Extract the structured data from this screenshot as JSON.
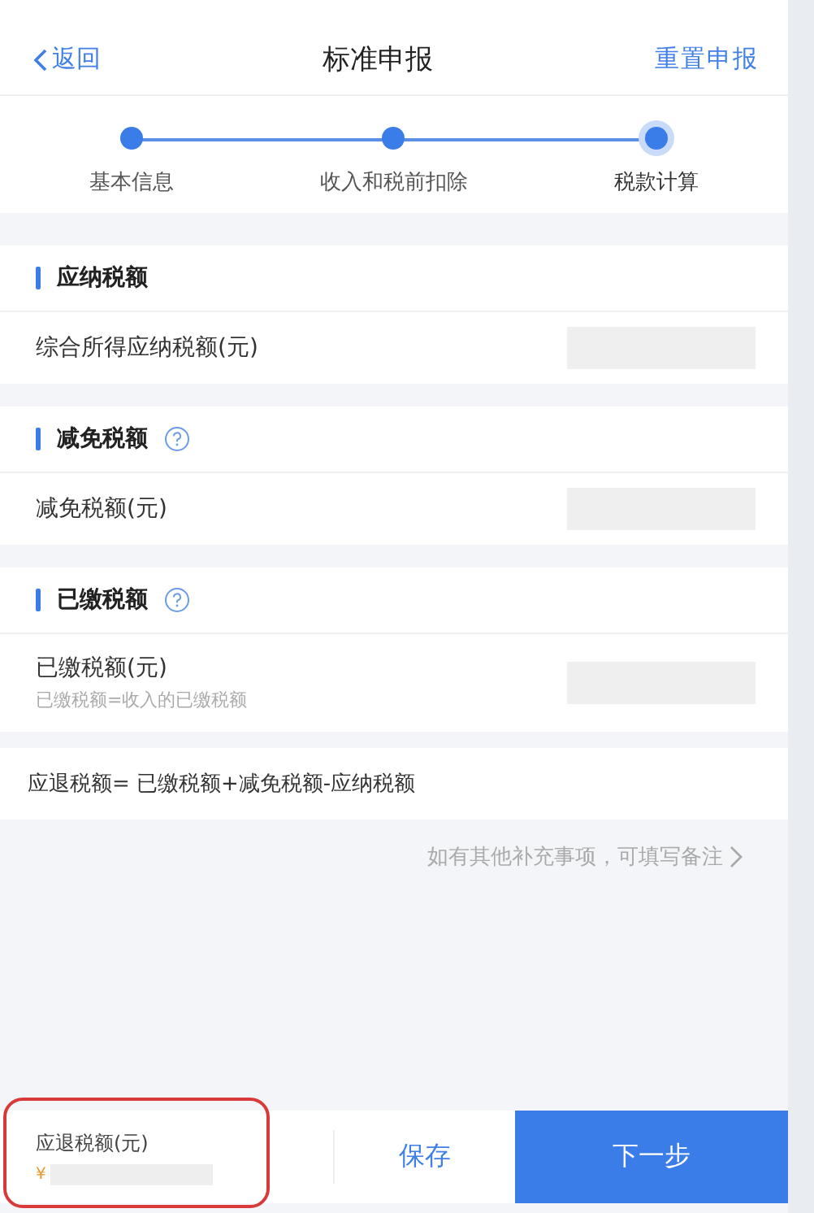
{
  "header": {
    "back": "返回",
    "title": "标准申报",
    "action": "重置申报"
  },
  "steps": [
    {
      "label": "基本信息",
      "selected": false
    },
    {
      "label": "收入和税前扣除",
      "selected": false
    },
    {
      "label": "税款计算",
      "selected": true
    }
  ],
  "sections": [
    {
      "title": "应纳税额",
      "help": false,
      "rows": [
        {
          "label": "综合所得应纳税额(元)"
        }
      ]
    },
    {
      "title": "减免税额",
      "help": true,
      "rows": [
        {
          "label": "减免税额(元)"
        }
      ]
    },
    {
      "title": "已缴税额",
      "help": true,
      "rows": [
        {
          "label": "已缴税额(元)",
          "hint": "已缴税额=收入的已缴税额"
        }
      ]
    }
  ],
  "formula": "应退税额= 已缴税额+减免税额-应纳税额",
  "note_link": "如有其他补充事项，可填写备注",
  "footer": {
    "label": "应退税额(元)",
    "currency": "¥",
    "highlighted": true,
    "save": "保存",
    "next": "下一步"
  }
}
